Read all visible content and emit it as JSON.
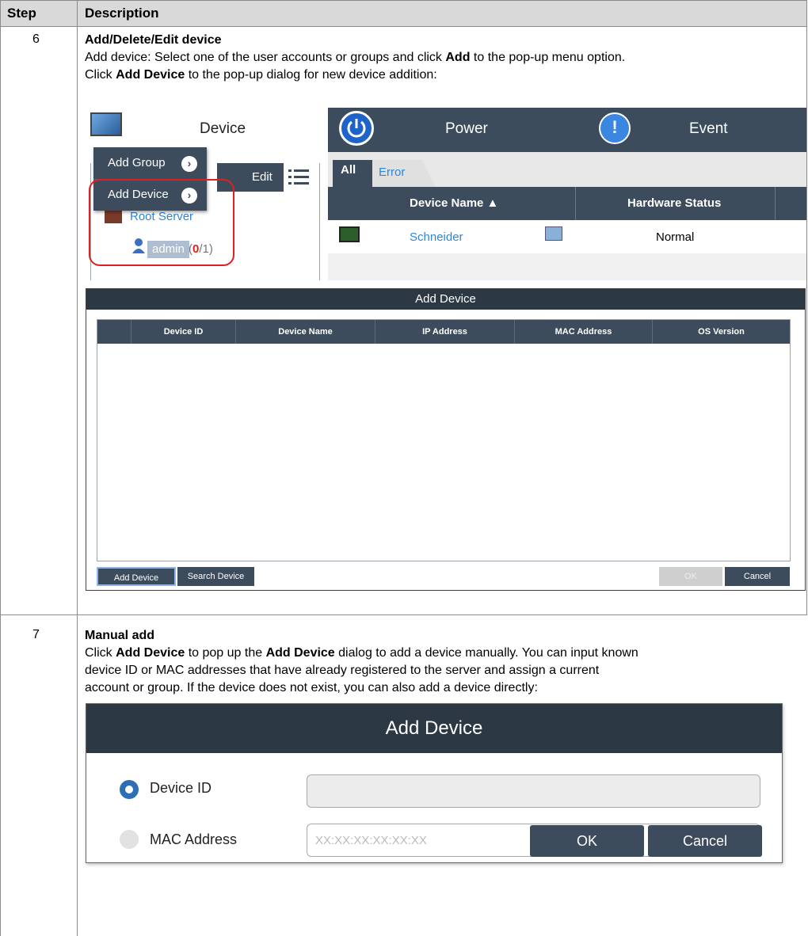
{
  "table": {
    "headers": {
      "step": "Step",
      "description": "Description"
    },
    "rows": [
      {
        "step": "6",
        "title": "Add/Delete/Edit device",
        "line1_pre": "Add device: Select one of the user accounts or groups and click ",
        "line1_bold": "Add",
        "line1_post": " to the pop-up menu option.",
        "line2_pre": "Click ",
        "line2_bold": "Add Device",
        "line2_post": " to the pop-up dialog for new device addition:"
      },
      {
        "step": "7",
        "title": "Manual add",
        "line1_pre": "Click ",
        "line1_bold1": "Add Device",
        "line1_mid": " to pop up the ",
        "line1_bold2": "Add Device",
        "line1_post": " dialog to add a device manually. You can input known",
        "line2": "device ID or MAC addresses that have already registered to the server and assign a current",
        "line3": "account or group. If the device does not exist, you can also add a device directly:"
      }
    ]
  },
  "device_ui": {
    "tabs": {
      "device": "Device",
      "power": "Power",
      "event": "Event"
    },
    "popup_menu": [
      "Add Group",
      "Add Device"
    ],
    "edit_button": "Edit",
    "tree": {
      "root": "Root Server",
      "user": "admin",
      "count_open": "(",
      "count_red": "0",
      "count_rest": "/1)"
    },
    "subtabs": {
      "all": "All",
      "error": "Error"
    },
    "columns": {
      "device_name": "Device Name ▲",
      "hardware_status": "Hardware Status"
    },
    "row": {
      "name": "Schneider",
      "status": "Normal"
    },
    "colors": {
      "dark": "#3d4c5c",
      "link": "#2e86d6",
      "alert": "#e02020"
    }
  },
  "add_device_list_dialog": {
    "title": "Add Device",
    "columns": [
      "Device ID",
      "Device Name",
      "IP Address",
      "MAC Address",
      "OS Version"
    ],
    "buttons": {
      "add": "Add Device",
      "search": "Search Device",
      "ok": "OK",
      "cancel": "Cancel"
    }
  },
  "manual_add_dialog": {
    "title": "Add Device",
    "options": [
      {
        "label": "Device ID",
        "selected": true,
        "placeholder": ""
      },
      {
        "label": "MAC Address",
        "selected": false,
        "placeholder": "XX:XX:XX:XX:XX:XX"
      }
    ],
    "buttons": {
      "ok": "OK",
      "cancel": "Cancel"
    }
  }
}
